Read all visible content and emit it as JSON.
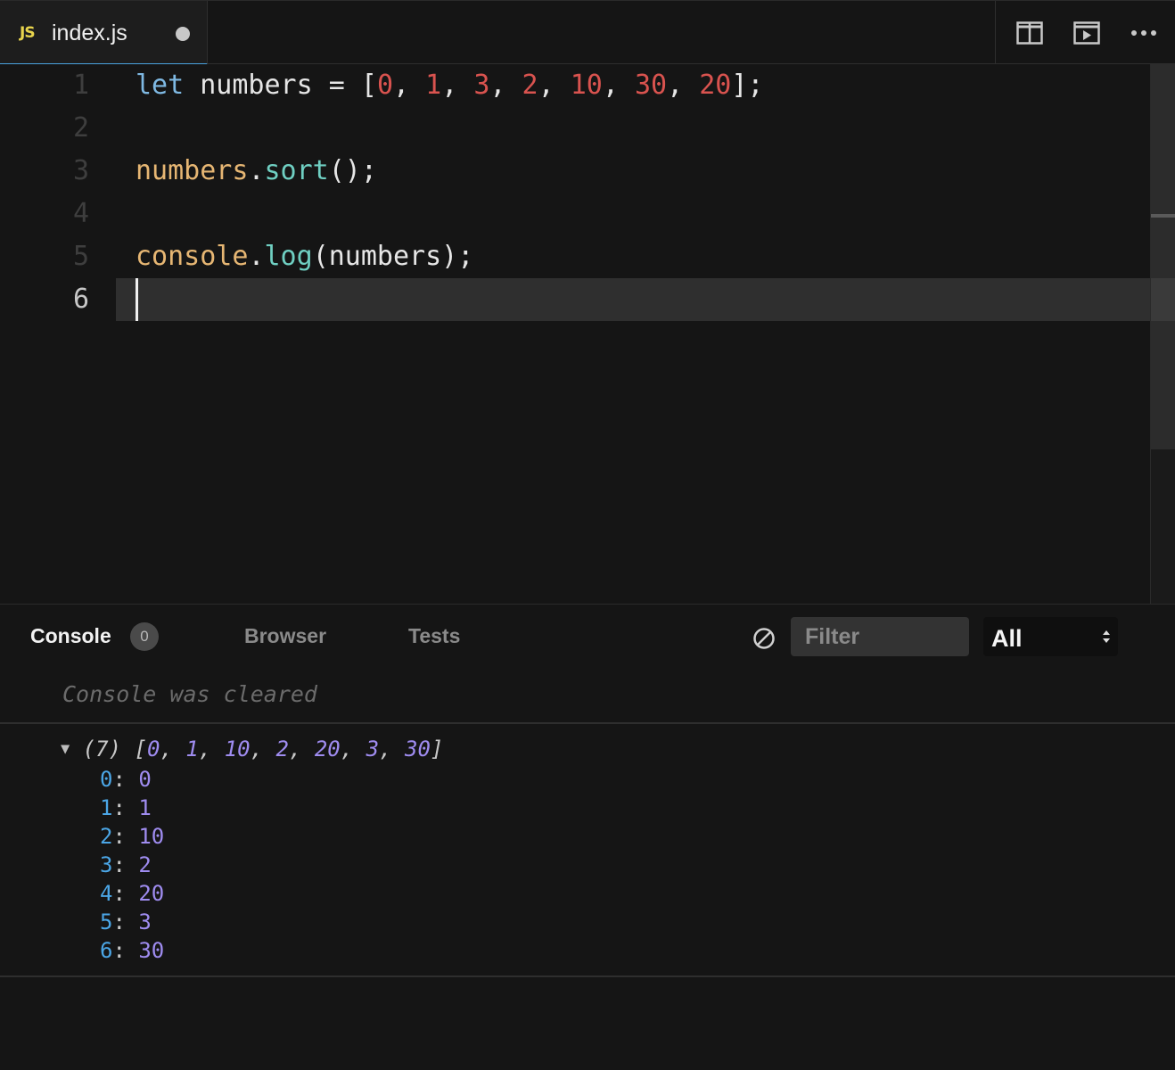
{
  "tab": {
    "icon_text": "JS",
    "filename": "index.js",
    "unsaved": true
  },
  "toolbar": {
    "buttons": [
      {
        "icon": "split-editor-icon"
      },
      {
        "icon": "open-preview-icon"
      },
      {
        "icon": "more-actions-icon"
      }
    ]
  },
  "editor": {
    "line_numbers": [
      "1",
      "2",
      "3",
      "4",
      "5",
      "6"
    ],
    "active_line": 6,
    "lines": {
      "line1": {
        "kw": "let",
        "name": "numbers",
        "assign": "=",
        "open": "[",
        "values": [
          "0",
          "1",
          "3",
          "2",
          "10",
          "30",
          "20"
        ],
        "close": "];"
      },
      "line3": {
        "obj": "numbers",
        "dot": ".",
        "fn": "sort",
        "rest": "();"
      },
      "line5": {
        "obj": "console",
        "dot": ".",
        "fn": "log",
        "rest": "(numbers);"
      }
    }
  },
  "console": {
    "tabs": {
      "console": "Console",
      "browser": "Browser",
      "tests": "Tests"
    },
    "badge_count": "0",
    "filter_placeholder": "Filter",
    "level_value": "All",
    "cleared_message": "Console was cleared",
    "log": {
      "length_label": "(7)",
      "values": [
        "0",
        "1",
        "10",
        "2",
        "20",
        "3",
        "30"
      ],
      "entries": [
        {
          "key": "0",
          "value": "0"
        },
        {
          "key": "1",
          "value": "1"
        },
        {
          "key": "2",
          "value": "10"
        },
        {
          "key": "3",
          "value": "2"
        },
        {
          "key": "4",
          "value": "20"
        },
        {
          "key": "5",
          "value": "3"
        },
        {
          "key": "6",
          "value": "30"
        }
      ]
    }
  }
}
